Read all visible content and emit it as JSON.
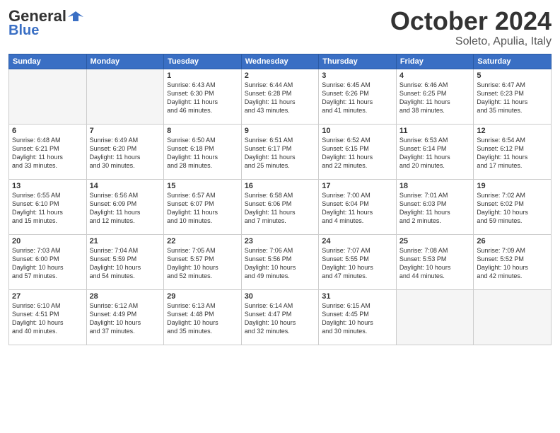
{
  "header": {
    "logo_general": "General",
    "logo_blue": "Blue",
    "logo_tagline": "Blue",
    "month_title": "October 2024",
    "location": "Soleto, Apulia, Italy"
  },
  "days_of_week": [
    "Sunday",
    "Monday",
    "Tuesday",
    "Wednesday",
    "Thursday",
    "Friday",
    "Saturday"
  ],
  "weeks": [
    [
      {
        "day": "",
        "info": ""
      },
      {
        "day": "",
        "info": ""
      },
      {
        "day": "1",
        "info": "Sunrise: 6:43 AM\nSunset: 6:30 PM\nDaylight: 11 hours\nand 46 minutes."
      },
      {
        "day": "2",
        "info": "Sunrise: 6:44 AM\nSunset: 6:28 PM\nDaylight: 11 hours\nand 43 minutes."
      },
      {
        "day": "3",
        "info": "Sunrise: 6:45 AM\nSunset: 6:26 PM\nDaylight: 11 hours\nand 41 minutes."
      },
      {
        "day": "4",
        "info": "Sunrise: 6:46 AM\nSunset: 6:25 PM\nDaylight: 11 hours\nand 38 minutes."
      },
      {
        "day": "5",
        "info": "Sunrise: 6:47 AM\nSunset: 6:23 PM\nDaylight: 11 hours\nand 35 minutes."
      }
    ],
    [
      {
        "day": "6",
        "info": "Sunrise: 6:48 AM\nSunset: 6:21 PM\nDaylight: 11 hours\nand 33 minutes."
      },
      {
        "day": "7",
        "info": "Sunrise: 6:49 AM\nSunset: 6:20 PM\nDaylight: 11 hours\nand 30 minutes."
      },
      {
        "day": "8",
        "info": "Sunrise: 6:50 AM\nSunset: 6:18 PM\nDaylight: 11 hours\nand 28 minutes."
      },
      {
        "day": "9",
        "info": "Sunrise: 6:51 AM\nSunset: 6:17 PM\nDaylight: 11 hours\nand 25 minutes."
      },
      {
        "day": "10",
        "info": "Sunrise: 6:52 AM\nSunset: 6:15 PM\nDaylight: 11 hours\nand 22 minutes."
      },
      {
        "day": "11",
        "info": "Sunrise: 6:53 AM\nSunset: 6:14 PM\nDaylight: 11 hours\nand 20 minutes."
      },
      {
        "day": "12",
        "info": "Sunrise: 6:54 AM\nSunset: 6:12 PM\nDaylight: 11 hours\nand 17 minutes."
      }
    ],
    [
      {
        "day": "13",
        "info": "Sunrise: 6:55 AM\nSunset: 6:10 PM\nDaylight: 11 hours\nand 15 minutes."
      },
      {
        "day": "14",
        "info": "Sunrise: 6:56 AM\nSunset: 6:09 PM\nDaylight: 11 hours\nand 12 minutes."
      },
      {
        "day": "15",
        "info": "Sunrise: 6:57 AM\nSunset: 6:07 PM\nDaylight: 11 hours\nand 10 minutes."
      },
      {
        "day": "16",
        "info": "Sunrise: 6:58 AM\nSunset: 6:06 PM\nDaylight: 11 hours\nand 7 minutes."
      },
      {
        "day": "17",
        "info": "Sunrise: 7:00 AM\nSunset: 6:04 PM\nDaylight: 11 hours\nand 4 minutes."
      },
      {
        "day": "18",
        "info": "Sunrise: 7:01 AM\nSunset: 6:03 PM\nDaylight: 11 hours\nand 2 minutes."
      },
      {
        "day": "19",
        "info": "Sunrise: 7:02 AM\nSunset: 6:02 PM\nDaylight: 10 hours\nand 59 minutes."
      }
    ],
    [
      {
        "day": "20",
        "info": "Sunrise: 7:03 AM\nSunset: 6:00 PM\nDaylight: 10 hours\nand 57 minutes."
      },
      {
        "day": "21",
        "info": "Sunrise: 7:04 AM\nSunset: 5:59 PM\nDaylight: 10 hours\nand 54 minutes."
      },
      {
        "day": "22",
        "info": "Sunrise: 7:05 AM\nSunset: 5:57 PM\nDaylight: 10 hours\nand 52 minutes."
      },
      {
        "day": "23",
        "info": "Sunrise: 7:06 AM\nSunset: 5:56 PM\nDaylight: 10 hours\nand 49 minutes."
      },
      {
        "day": "24",
        "info": "Sunrise: 7:07 AM\nSunset: 5:55 PM\nDaylight: 10 hours\nand 47 minutes."
      },
      {
        "day": "25",
        "info": "Sunrise: 7:08 AM\nSunset: 5:53 PM\nDaylight: 10 hours\nand 44 minutes."
      },
      {
        "day": "26",
        "info": "Sunrise: 7:09 AM\nSunset: 5:52 PM\nDaylight: 10 hours\nand 42 minutes."
      }
    ],
    [
      {
        "day": "27",
        "info": "Sunrise: 6:10 AM\nSunset: 4:51 PM\nDaylight: 10 hours\nand 40 minutes."
      },
      {
        "day": "28",
        "info": "Sunrise: 6:12 AM\nSunset: 4:49 PM\nDaylight: 10 hours\nand 37 minutes."
      },
      {
        "day": "29",
        "info": "Sunrise: 6:13 AM\nSunset: 4:48 PM\nDaylight: 10 hours\nand 35 minutes."
      },
      {
        "day": "30",
        "info": "Sunrise: 6:14 AM\nSunset: 4:47 PM\nDaylight: 10 hours\nand 32 minutes."
      },
      {
        "day": "31",
        "info": "Sunrise: 6:15 AM\nSunset: 4:45 PM\nDaylight: 10 hours\nand 30 minutes."
      },
      {
        "day": "",
        "info": ""
      },
      {
        "day": "",
        "info": ""
      }
    ]
  ]
}
